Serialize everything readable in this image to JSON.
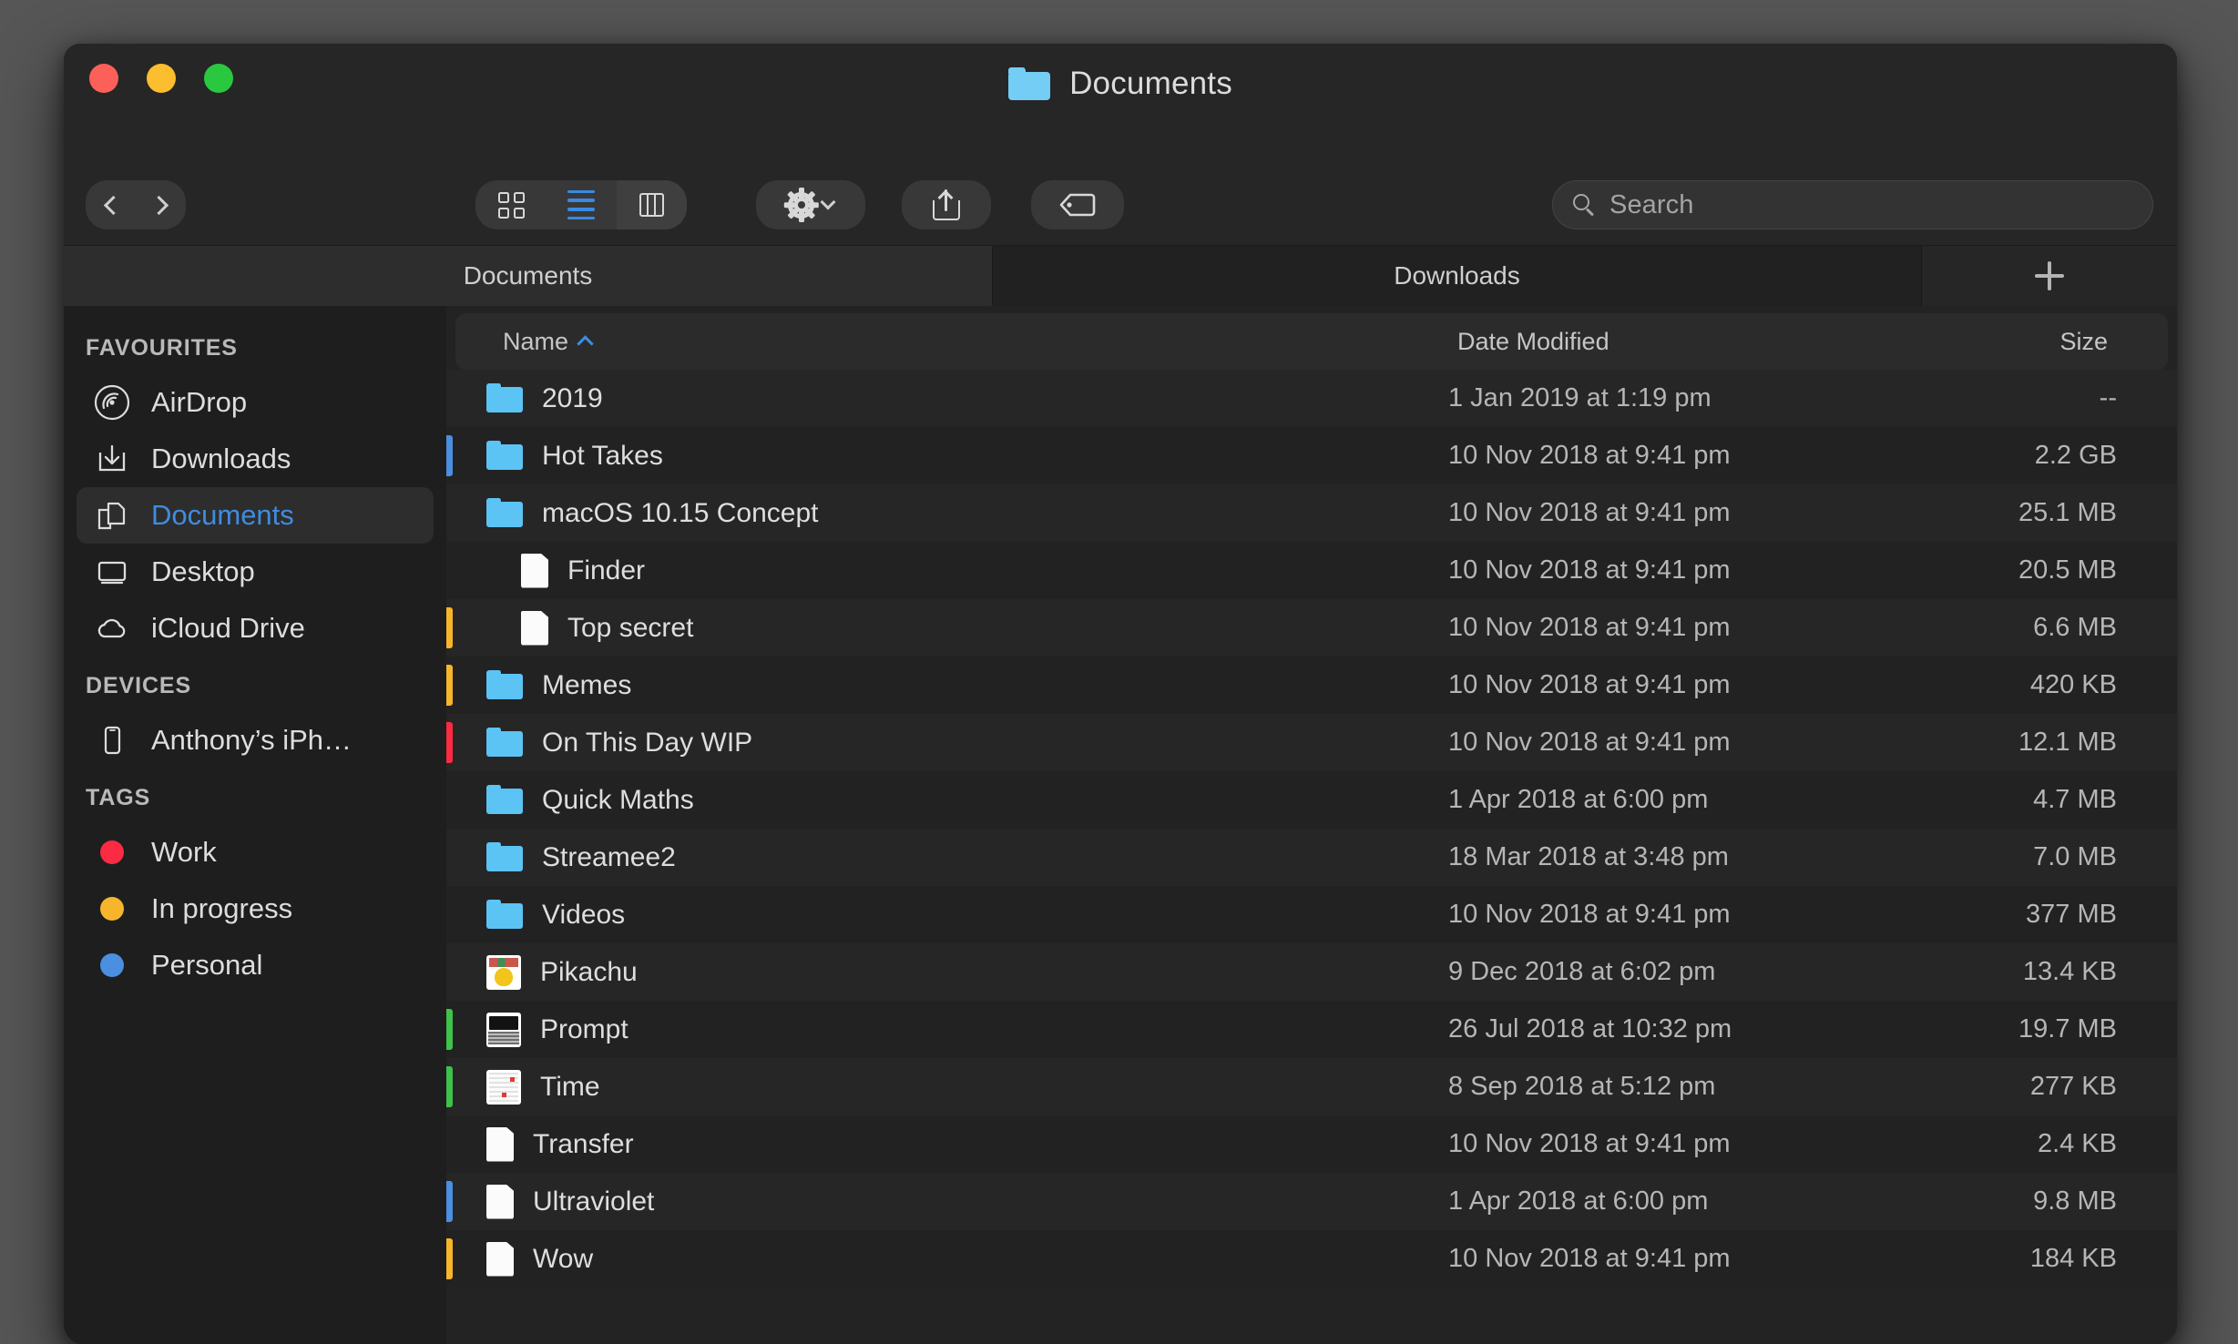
{
  "window": {
    "title": "Documents",
    "title_icon": "folder-icon",
    "traffic_lights": [
      {
        "name": "close",
        "color": "#fc6058"
      },
      {
        "name": "minimize",
        "color": "#fcbd2e"
      },
      {
        "name": "maximize",
        "color": "#2ac83f"
      }
    ]
  },
  "toolbar": {
    "back_icon": "chevron-left-icon",
    "forward_icon": "chevron-right-icon",
    "view_icon_label": "icon-view-icon",
    "view_list_label": "list-view-icon",
    "view_column_label": "column-view-icon",
    "active_view": "list",
    "action_icon": "gear-icon",
    "action_chevron": "chevron-down-icon",
    "share_icon": "share-icon",
    "tag_icon": "tag-icon",
    "accent_color": "#3a8ae2"
  },
  "search": {
    "placeholder": "Search",
    "value": "",
    "icon": "search-icon"
  },
  "tabs": {
    "items": [
      {
        "label": "Documents",
        "active": true
      },
      {
        "label": "Downloads",
        "active": false
      }
    ],
    "new_tab_icon": "plus-icon"
  },
  "sidebar": {
    "sections": [
      {
        "header": "FAVOURITES",
        "items": [
          {
            "label": "AirDrop",
            "icon": "airdrop-icon",
            "selected": false
          },
          {
            "label": "Downloads",
            "icon": "download-icon",
            "selected": false
          },
          {
            "label": "Documents",
            "icon": "documents-icon",
            "selected": true
          },
          {
            "label": "Desktop",
            "icon": "desktop-icon",
            "selected": false
          },
          {
            "label": "iCloud Drive",
            "icon": "cloud-icon",
            "selected": false
          }
        ]
      },
      {
        "header": "DEVICES",
        "items": [
          {
            "label": "Anthony’s iPh…",
            "icon": "iphone-icon",
            "selected": false
          }
        ]
      },
      {
        "header": "TAGS",
        "items": [
          {
            "label": "Work",
            "icon": "tag-dot-icon",
            "color": "#fa2b42",
            "selected": false
          },
          {
            "label": "In progress",
            "icon": "tag-dot-icon",
            "color": "#f7b52c",
            "selected": false
          },
          {
            "label": "Personal",
            "icon": "tag-dot-icon",
            "color": "#4a8fe0",
            "selected": false
          }
        ]
      }
    ],
    "selected_color": "#3f8ce0"
  },
  "file_list": {
    "columns": [
      "Name",
      "Date Modified",
      "Size"
    ],
    "sort_column": "Name",
    "sort_direction": "ascending",
    "sort_icon": "chevron-up-icon",
    "rows": [
      {
        "name": "2019",
        "date": "1 Jan 2019 at 1:19 pm",
        "size": "--",
        "icon": "folder-icon",
        "tag": "",
        "indent": false
      },
      {
        "name": "Hot Takes",
        "date": "10 Nov 2018 at 9:41 pm",
        "size": "2.2 GB",
        "icon": "folder-icon",
        "tag": "#4a8fe0",
        "indent": false
      },
      {
        "name": "macOS 10.15 Concept",
        "date": "10 Nov 2018 at 9:41 pm",
        "size": "25.1 MB",
        "icon": "folder-open-icon",
        "tag": "",
        "indent": false
      },
      {
        "name": "Finder",
        "date": "10 Nov 2018 at 9:41 pm",
        "size": "20.5 MB",
        "icon": "document-icon",
        "tag": "",
        "indent": true
      },
      {
        "name": "Top secret",
        "date": "10 Nov 2018 at 9:41 pm",
        "size": "6.6 MB",
        "icon": "document-icon",
        "tag": "#f7b52c",
        "indent": true
      },
      {
        "name": "Memes",
        "date": "10 Nov 2018 at 9:41 pm",
        "size": "420 KB",
        "icon": "folder-icon",
        "tag": "#f7b52c",
        "indent": false
      },
      {
        "name": "On This Day WIP",
        "date": "10 Nov 2018 at 9:41 pm",
        "size": "12.1 MB",
        "icon": "folder-icon",
        "tag": "#fa2b42",
        "indent": false
      },
      {
        "name": "Quick Maths",
        "date": "1 Apr 2018 at 6:00 pm",
        "size": "4.7 MB",
        "icon": "folder-icon",
        "tag": "",
        "indent": false
      },
      {
        "name": "Streamee2",
        "date": "18 Mar 2018 at 3:48 pm",
        "size": "7.0 MB",
        "icon": "folder-icon",
        "tag": "",
        "indent": false
      },
      {
        "name": "Videos",
        "date": "10 Nov 2018 at 9:41 pm",
        "size": "377 MB",
        "icon": "folder-icon",
        "tag": "",
        "indent": false
      },
      {
        "name": "Pikachu",
        "date": "9 Dec 2018 at 6:02 pm",
        "size": "13.4 KB",
        "icon": "image-thumbnail-pikachu",
        "tag": "",
        "indent": false
      },
      {
        "name": "Prompt",
        "date": "26 Jul 2018 at 10:32 pm",
        "size": "19.7 MB",
        "icon": "image-thumbnail-prompt",
        "tag": "#3fc24a",
        "indent": false
      },
      {
        "name": "Time",
        "date": "8 Sep 2018 at 5:12 pm",
        "size": "277 KB",
        "icon": "image-thumbnail-time",
        "tag": "#3fc24a",
        "indent": false
      },
      {
        "name": "Transfer",
        "date": "10 Nov 2018 at 9:41 pm",
        "size": "2.4 KB",
        "icon": "document-icon",
        "tag": "",
        "indent": false
      },
      {
        "name": "Ultraviolet",
        "date": "1 Apr 2018 at 6:00 pm",
        "size": "9.8 MB",
        "icon": "document-icon",
        "tag": "#4a8fe0",
        "indent": false
      },
      {
        "name": "Wow",
        "date": "10 Nov 2018 at 9:41 pm",
        "size": "184 KB",
        "icon": "document-icon",
        "tag": "#f7b52c",
        "indent": false
      }
    ]
  }
}
